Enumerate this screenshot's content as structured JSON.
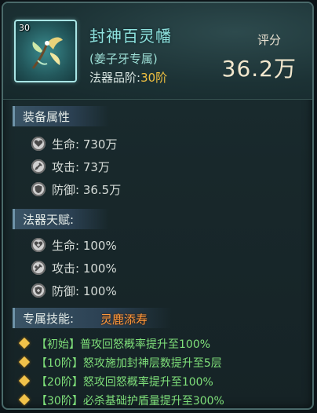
{
  "item": {
    "level": "30",
    "name": "封神百灵幡",
    "owner": "(姜子牙专属)",
    "grade_label": "法器品阶:",
    "grade_value": "30阶",
    "score_label": "评分",
    "score_value": "36.2万"
  },
  "equip_attrs": {
    "title": "装备属性",
    "rows": [
      {
        "icon": "heart-icon",
        "text": "生命: 730万"
      },
      {
        "icon": "sword-icon",
        "text": "攻击: 73万"
      },
      {
        "icon": "shield-icon",
        "text": "防御: 36.5万"
      }
    ]
  },
  "talent": {
    "title": "法器天赋:",
    "rows": [
      {
        "icon": "heart-plus-icon",
        "text": "生命: 100%"
      },
      {
        "icon": "sword-plus-icon",
        "text": "攻击: 100%"
      },
      {
        "icon": "shield-plus-icon",
        "text": "防御: 100%"
      }
    ]
  },
  "skill": {
    "title": "专属技能:",
    "name": "灵鹿添寿",
    "tiers": [
      "【初始】普攻回怒概率提升至100%",
      "【10阶】怒攻施加封神层数提升至5层",
      "【20阶】怒攻回怒概率提升至100%",
      "【30阶】必杀基础护盾量提升至300%"
    ]
  },
  "colors": {
    "item_name": "#8fe3df",
    "grade_value": "#f0c040",
    "skill_name": "#ff9a3c",
    "skill_tier_text": "#7fe07a",
    "diamond_bullet": "#f1c24a"
  }
}
